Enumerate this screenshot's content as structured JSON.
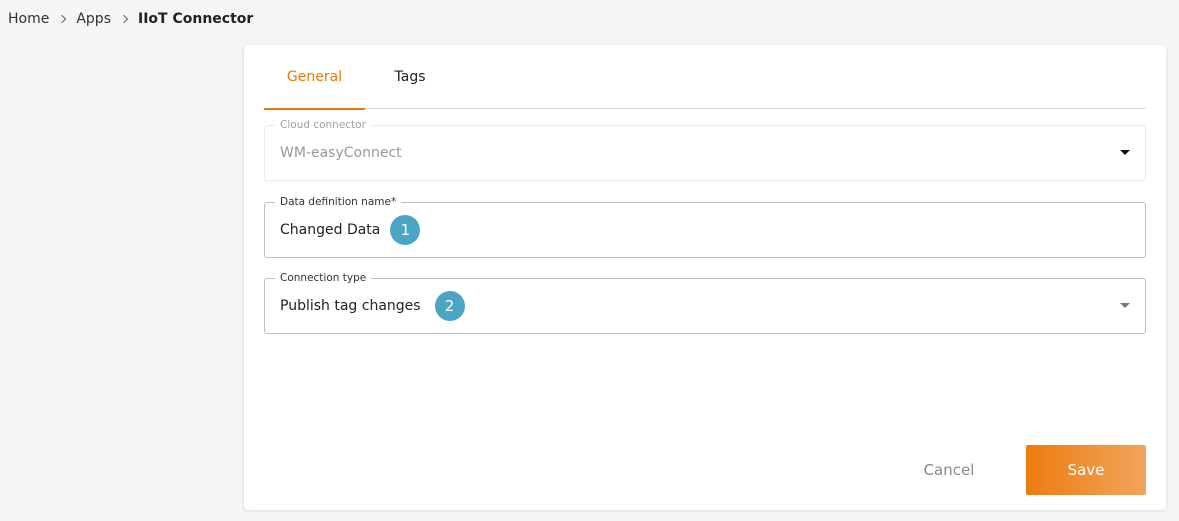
{
  "breadcrumb": {
    "items": [
      "Home",
      "Apps"
    ],
    "current": "IIoT Connector"
  },
  "tabs": [
    {
      "label": "General",
      "active": true
    },
    {
      "label": "Tags",
      "active": false
    }
  ],
  "form": {
    "cloud_connector": {
      "label": "Cloud connector",
      "value": "WM-easyConnect",
      "disabled": true
    },
    "data_definition_name": {
      "label": "Data definition name*",
      "value": "Changed Data",
      "step_badge": "1"
    },
    "connection_type": {
      "label": "Connection type",
      "value": "Publish tag changes",
      "step_badge": "2"
    }
  },
  "actions": {
    "cancel_label": "Cancel",
    "save_label": "Save"
  },
  "colors": {
    "accent": "#e8780d",
    "badge": "#4ba6c6",
    "save_gradient_start": "#ec7c0f",
    "save_gradient_end": "#f0a55c"
  },
  "icons": {
    "breadcrumb_separator": "chevron-right-icon",
    "dropdown": "caret-down-icon"
  }
}
